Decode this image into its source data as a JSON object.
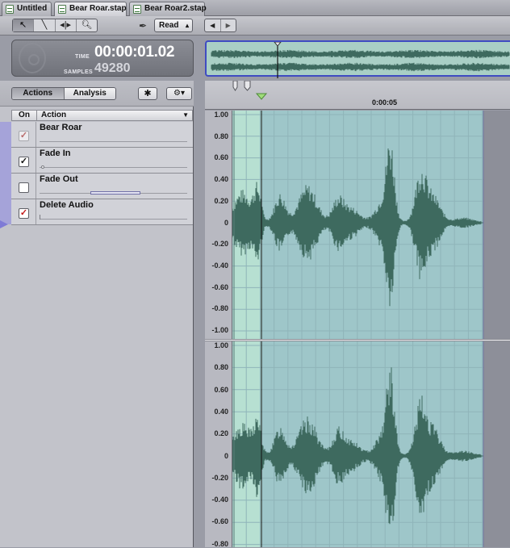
{
  "tabs": [
    {
      "label": "Untitled",
      "active": false
    },
    {
      "label": "Bear Roar.stap",
      "active": true
    },
    {
      "label": "Bear Roar2.stap",
      "active": false
    }
  ],
  "toolbar": {
    "tools": [
      "arrow-tool-icon",
      "pencil-tool-icon",
      "scrub-tool-icon",
      "zoom-tool-icon"
    ],
    "automation_mode": "Read"
  },
  "time_display": {
    "time_label": "TIME",
    "time_value": "00:00:01.02",
    "samples_label": "SAMPLES",
    "samples_value": "49280"
  },
  "panel": {
    "tab_actions": "Actions",
    "tab_analysis": "Analysis",
    "col_on": "On",
    "col_action": "Action",
    "actions": [
      {
        "name": "Bear Roar",
        "checked": true,
        "enabled": false
      },
      {
        "name": "Fade In",
        "checked": true,
        "enabled": true
      },
      {
        "name": "Fade Out",
        "checked": false,
        "enabled": true
      },
      {
        "name": "Delete Audio",
        "checked": true,
        "enabled": true
      }
    ]
  },
  "timeline": {
    "ruler_label": "0:00:05"
  },
  "y_axis_labels": [
    "1.00",
    "0.80",
    "0.60",
    "0.40",
    "0.20",
    "0",
    "-0.20",
    "-0.40",
    "-0.60",
    "-0.80",
    "-1.00"
  ],
  "y_axis_labels_ch2": [
    "1.00",
    "0.80",
    "0.60",
    "0.40",
    "0.20",
    "0",
    "-0.20",
    "-0.40",
    "-0.60",
    "-0.80"
  ],
  "colors": {
    "waveform": "#3e6a5f",
    "wave_bg": "#9ec6c9",
    "selection": "#b7e0d2",
    "accent": "#3f4cc2"
  }
}
